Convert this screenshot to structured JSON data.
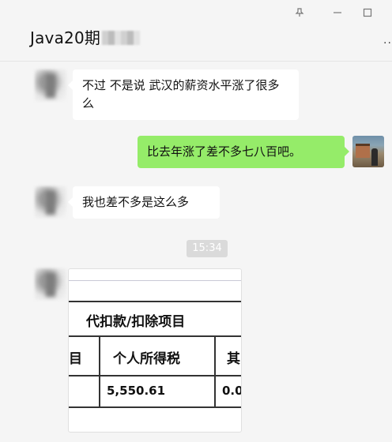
{
  "header": {
    "title": "Java20期",
    "pin_icon": "pin-icon",
    "minimize_icon": "minimize-icon",
    "maximize_icon": "maximize-icon",
    "more_label": "···"
  },
  "messages": [
    {
      "side": "left",
      "avatar": "blurred-avatar",
      "text": "不过 不是说 武汉的薪资水平涨了很多么"
    },
    {
      "side": "right",
      "avatar": "photo-avatar",
      "text": "比去年涨了差不多七八百吧。"
    },
    {
      "side": "left",
      "avatar": "blurred-avatar",
      "text": "我也差不多是这么多"
    }
  ],
  "timestamp": "15:34",
  "image_message": {
    "heading": "代扣款/扣除项目",
    "col_left_partial": "目",
    "col_header": "个人所得税",
    "col_right_partial": "其",
    "value": "5,550.61",
    "value_right_partial": "0.0"
  },
  "colors": {
    "sent_bubble": "#95ec69",
    "received_bubble": "#ffffff",
    "background": "#f5f5f5"
  }
}
